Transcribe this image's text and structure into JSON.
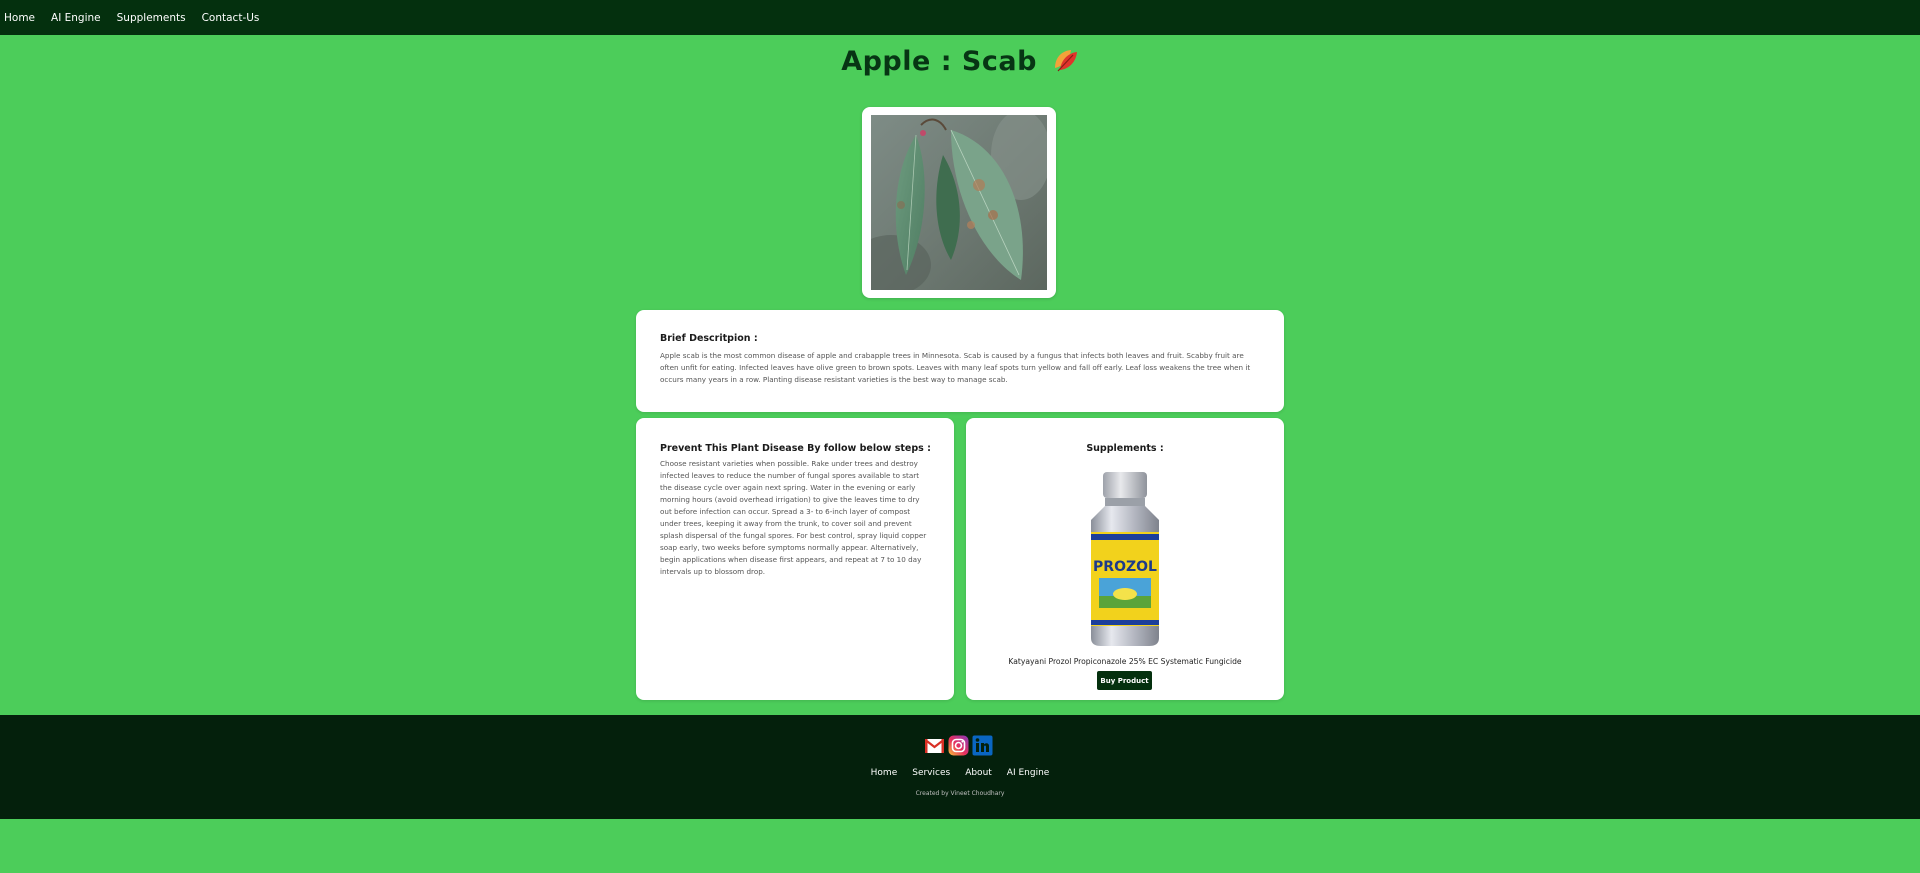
{
  "nav": {
    "items": [
      "Home",
      "AI Engine",
      "Supplements",
      "Contact-Us"
    ]
  },
  "page": {
    "title": "Apple : Scab",
    "title_icon": "leaf-icon"
  },
  "description": {
    "heading": "Brief Descritpion :",
    "text": "Apple scab is the most common disease of apple and crabapple trees in Minnesota. Scab is caused by a fungus that infects both leaves and fruit. Scabby fruit are often unfit for eating. Infected leaves have olive green to brown spots. Leaves with many leaf spots turn yellow and fall off early. Leaf loss weakens the tree when it occurs many years in a row. Planting disease resistant varieties is the best way to manage scab."
  },
  "prevention": {
    "heading": "Prevent This Plant Disease By follow below steps :",
    "text": "Choose resistant varieties when possible. Rake under trees and destroy infected leaves to reduce the number of fungal spores available to start the disease cycle over again next spring. Water in the evening or early morning hours (avoid overhead irrigation) to give the leaves time to dry out before infection can occur. Spread a 3- to 6-inch layer of compost under trees, keeping it away from the trunk, to cover soil and prevent splash dispersal of the fungal spores. For best control, spray liquid copper soap early, two weeks before symptoms normally appear. Alternatively, begin applications when disease first appears, and repeat at 7 to 10 day intervals up to blossom drop."
  },
  "supplements": {
    "heading": "Supplements :",
    "product_name": "Katyayani Prozol Propiconazole 25% EC Systematic Fungicide",
    "product_label": "PROZOL",
    "buy_label": "Buy Product"
  },
  "footer": {
    "social": [
      "gmail-icon",
      "instagram-icon",
      "linkedin-icon"
    ],
    "links": [
      "Home",
      "Services",
      "About",
      "AI Engine"
    ],
    "credit": "Created by Vineet Choudhary"
  },
  "colors": {
    "background": "#4ccd5a",
    "nav": "#04300e",
    "footer": "#04200c",
    "title": "#073514",
    "button": "#04300e"
  }
}
